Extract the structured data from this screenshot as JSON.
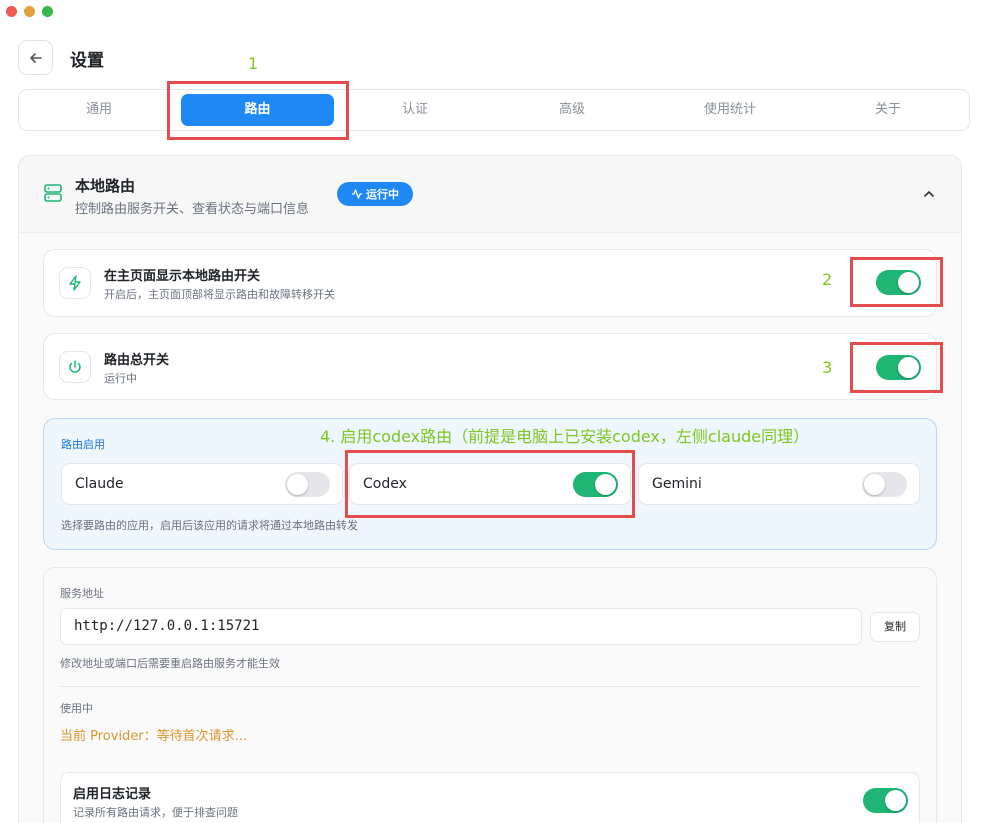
{
  "window": {
    "controls": [
      "close",
      "minimize",
      "maximize"
    ]
  },
  "header": {
    "title": "设置",
    "back_label": "返回"
  },
  "tabs": [
    {
      "label": "通用",
      "active": false
    },
    {
      "label": "路由",
      "active": true
    },
    {
      "label": "认证",
      "active": false
    },
    {
      "label": "高级",
      "active": false
    },
    {
      "label": "使用统计",
      "active": false
    },
    {
      "label": "关于",
      "active": false
    }
  ],
  "annotations": {
    "n1": "1",
    "n2": "2",
    "n3": "3",
    "n4": "4. 启用codex路由（前提是电脑上已安装codex，左侧claude同理）"
  },
  "panel": {
    "title": "本地路由",
    "subtitle": "控制路由服务开关、查看状态与端口信息",
    "badge": "运行中"
  },
  "toggles": [
    {
      "title": "在主页面显示本地路由开关",
      "desc": "开启后，主页面顶部将显示路由和故障转移开关",
      "on": true,
      "icon": "lightning-icon"
    },
    {
      "title": "路由总开关",
      "desc": "运行中",
      "on": true,
      "icon": "power-icon"
    }
  ],
  "routing": {
    "label": "路由启用",
    "apps": [
      {
        "name": "Claude",
        "on": false
      },
      {
        "name": "Codex",
        "on": true
      },
      {
        "name": "Gemini",
        "on": false
      }
    ],
    "hint": "选择要路由的应用，启用后该应用的请求将通过本地路由转发"
  },
  "service": {
    "label": "服务地址",
    "address": "http://127.0.0.1:15721",
    "copy_label": "复制",
    "hint": "修改地址或端口后需要重启路由服务才能生效",
    "in_use_label": "使用中",
    "provider": "当前 Provider：等待首次请求..."
  },
  "logging": {
    "title": "启用日志记录",
    "desc": "记录所有路由请求，便于排查问题",
    "on": true
  },
  "colors": {
    "accent": "#1e88f5",
    "toggle_on": "#1fb574",
    "annotation": "#7dc71f",
    "highlight": "#e54d4d",
    "provider": "#d9962f"
  }
}
